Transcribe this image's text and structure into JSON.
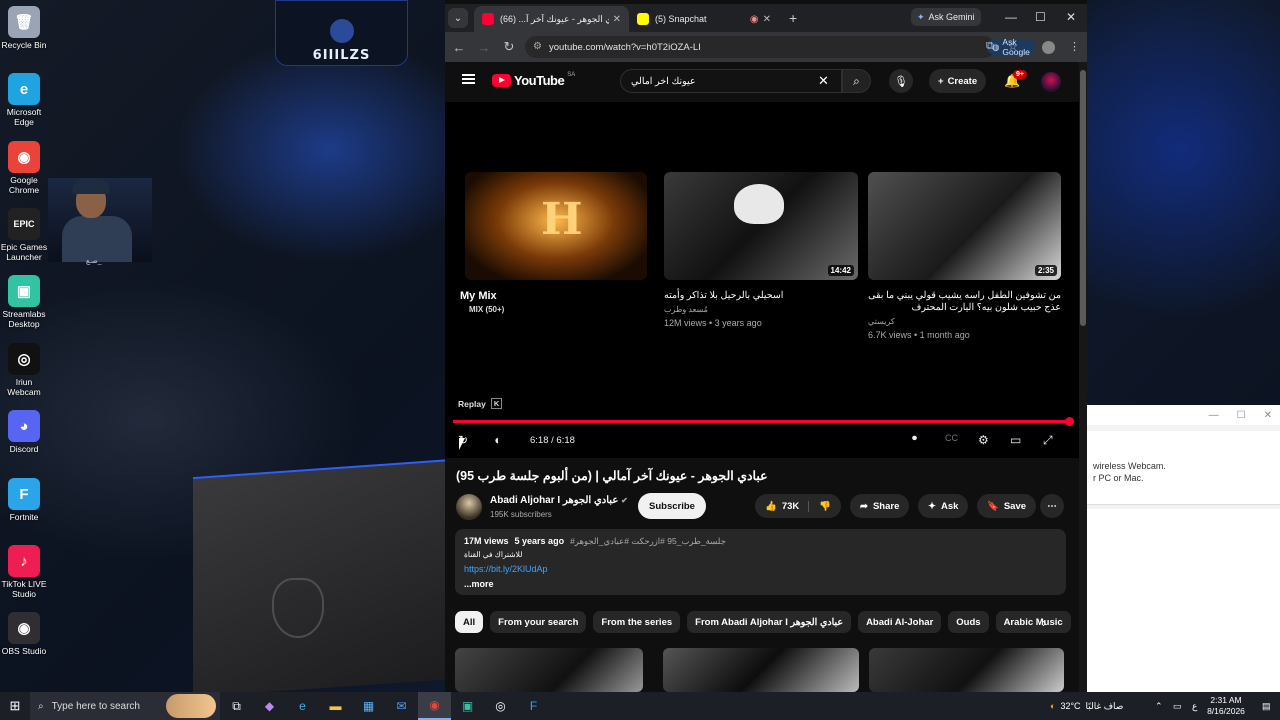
{
  "desktop": {
    "icons": [
      {
        "label": "Recycle Bin",
        "glyph": "🗑",
        "color": "#9aa4b4"
      },
      {
        "label": "Microsoft Edge",
        "glyph": "e",
        "color": "#1fa4e0"
      },
      {
        "label": "Google Chrome",
        "glyph": "◉",
        "color": "#e9433a"
      },
      {
        "label": "Epic Games Launcher",
        "glyph": "EPIC",
        "color": "#222222"
      },
      {
        "label": "Streamlabs Desktop",
        "glyph": "▣",
        "color": "#31c3a2"
      },
      {
        "label": "Iriun Webcam",
        "glyph": "◎",
        "color": "#111111"
      },
      {
        "label": "Discord",
        "glyph": "◕",
        "color": "#5865f2"
      },
      {
        "label": "Fortnite",
        "glyph": "F",
        "color": "#2aa5e8"
      },
      {
        "label": "TikTok LIVE Studio",
        "glyph": "♪",
        "color": "#ee1d52"
      },
      {
        "label": "OBS Studio",
        "glyph": "◉",
        "color": "#302e31"
      }
    ],
    "logo_text": "6IIILZS",
    "webcam_caption": "صـع_",
    "side_window": {
      "text1": "wireless Webcam.",
      "text2": "r PC or Mac."
    }
  },
  "browser": {
    "tabs": [
      {
        "title": "عبادي الجوهر - عيونك آخر آ... (66)",
        "favicon_color": "#ff0033"
      },
      {
        "title": "(5) Snapchat",
        "favicon_color": "#fffc00"
      }
    ],
    "ask_gemini": "Ask Gemini",
    "url": "youtube.com/watch?v=h0T2iOZA-LI",
    "ask_google": "Ask Google"
  },
  "youtube": {
    "logo": "YouTube",
    "country": "SA",
    "search_value": "عيونك اخر امالي",
    "create_label": "Create",
    "notif_badge": "9+",
    "endscreen": [
      {
        "title": "My Mix",
        "sub": "MIX (50+)",
        "meta": "",
        "duration": ""
      },
      {
        "title": "اسحيلي بالرحيل بلا تذاكر وأمته",
        "sub": "مُسعد وطرب",
        "meta": "12M views • 3 years ago",
        "duration": "14:42"
      },
      {
        "title": "من تشوفين الطفل راسه يشيب قولي يبني ما بقى عذج حبيب شلون بيه؟ اليارت المحترف",
        "sub": "كريستي",
        "meta": "6.7K views • 1 month ago",
        "duration": "2:35"
      }
    ],
    "replay_label": "Replay",
    "replay_key": "K",
    "timecode": "6:18 / 6:18",
    "video_title": "عبادي الجوهر - عيونك آخر آمالي | (من ألبوم جلسة طرب 95)",
    "channel_name": "Abadi Aljohar I عبادي الجوهر",
    "channel_subs": "195K subscribers",
    "subscribe_label": "Subscribe",
    "likes": "73K",
    "share_label": "Share",
    "ask_label": "Ask",
    "save_label": "Save",
    "description": {
      "views": "17M views",
      "age": "5 years ago",
      "tags": "#جلسة_طرب_95 #ازرحكت #عبادي_الجوهر",
      "line2": "للاشتراك في القناة",
      "link": "https://bit.ly/2KlUdAp",
      "more": "...more"
    },
    "chips": [
      "All",
      "From your search",
      "From the series",
      "From Abadi Aljohar I عبادي الجوهر",
      "Abadi Al-Johar",
      "Ouds",
      "Arabic Music"
    ]
  },
  "taskbar": {
    "search_placeholder": "Type here to search",
    "weather": "32°C",
    "weather_text": "صاف غالبًا",
    "lang": "ع",
    "time": "2:31 AM",
    "date": "8/16/2026"
  }
}
